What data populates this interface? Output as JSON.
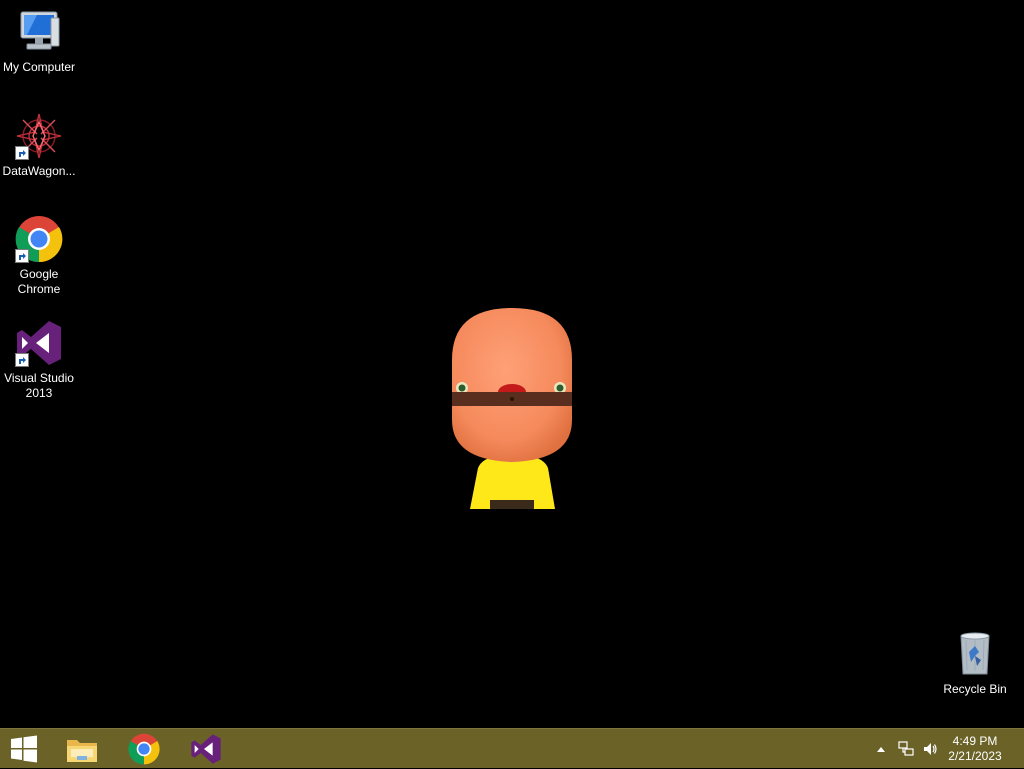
{
  "desktop": {
    "icons": [
      {
        "label": "My Computer"
      },
      {
        "label": "DataWagon..."
      },
      {
        "label": "Google Chrome"
      },
      {
        "label": "Visual Studio 2013"
      },
      {
        "label": "Recycle Bin"
      }
    ]
  },
  "taskbar": {
    "pinned": [
      {
        "name": "file-explorer-icon"
      },
      {
        "name": "chrome-icon"
      },
      {
        "name": "visual-studio-icon"
      }
    ],
    "tray": {
      "time": "4:49 PM",
      "date": "2/21/2023"
    }
  },
  "colors": {
    "taskbar": "#6b6228",
    "desktop": "#000000",
    "vs_purple": "#68217a"
  }
}
